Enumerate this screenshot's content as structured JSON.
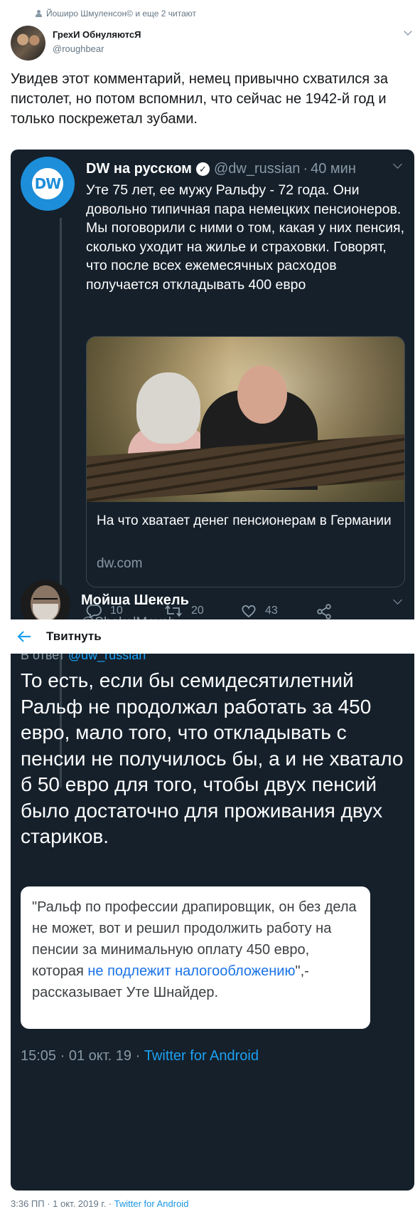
{
  "reading_line": "Йоширо Шмуленсон© и еще 2 читают",
  "outer_tweet": {
    "author_name": "ГрехИ ОбнуляютсЯ",
    "author_handle": "@roughbear",
    "text": "Увидев этот комментарий, немец привычно схватился за пистолет, но потом вспомнил, что сейчас не 1942-й год и только поскрежетал зубами.",
    "date": "3:36 ПП · 1 окт. 2019 г. · ",
    "source": "Twitter for Android"
  },
  "embedded": {
    "tweet1": {
      "avatar_text": "DW",
      "author_name": "DW на русском",
      "verified_mark": "✓",
      "author_handle": "@dw_russian",
      "separator": "·",
      "time": "40 мин",
      "text": "Уте 75 лет, ее мужу Ральфу - 72 года. Они довольно типичная пара немецких пенсионеров. Мы поговорили с ними о том, какая у них пенсия, сколько уходит на жилье и страховки. Говорят, что после всех ежемесячных расходов получается откладывать 400 евро",
      "card": {
        "title": "На что хватает денег пенсионерам в Германии",
        "domain": "dw.com"
      },
      "actions": {
        "replies": "10",
        "retweets": "20",
        "likes": "43"
      }
    },
    "tweet2": {
      "author_name": "Мойша Шекель",
      "author_handle": "@ShekelMoysh",
      "replying_prefix": "В ответ ",
      "replying_mention": "@dw_russian",
      "text": "То есть, если бы семидесятилетний Ральф не продолжал работать за 450 евро, мало того, что откладывать с пенсии не получилось бы, а и не хватало б 50 евро для того, чтобы двух пенсий было достаточно для проживания двух стариков.",
      "quote_before": "\"Ральф по профессии драпировщик, он без дела не может, вот и решил продолжить работу на пенсии за минимальную оплату 450 евро, которая ",
      "quote_link": "не подлежит налогообложению",
      "quote_after": "\",- рассказывает Уте Шнайдер.",
      "meta_time": "15:05 · 01 окт. 19 · ",
      "meta_source": "Twitter for Android"
    },
    "topbar": {
      "title": "Твитнуть"
    }
  },
  "colors": {
    "dark_bg": "#15202b",
    "accent": "#1da1f2",
    "dw_blue": "#1d8ed9"
  },
  "icons": [
    "person-icon",
    "chevron-down-icon",
    "verified-icon",
    "reply-icon",
    "retweet-icon",
    "like-icon",
    "share-icon",
    "back-arrow-icon"
  ]
}
